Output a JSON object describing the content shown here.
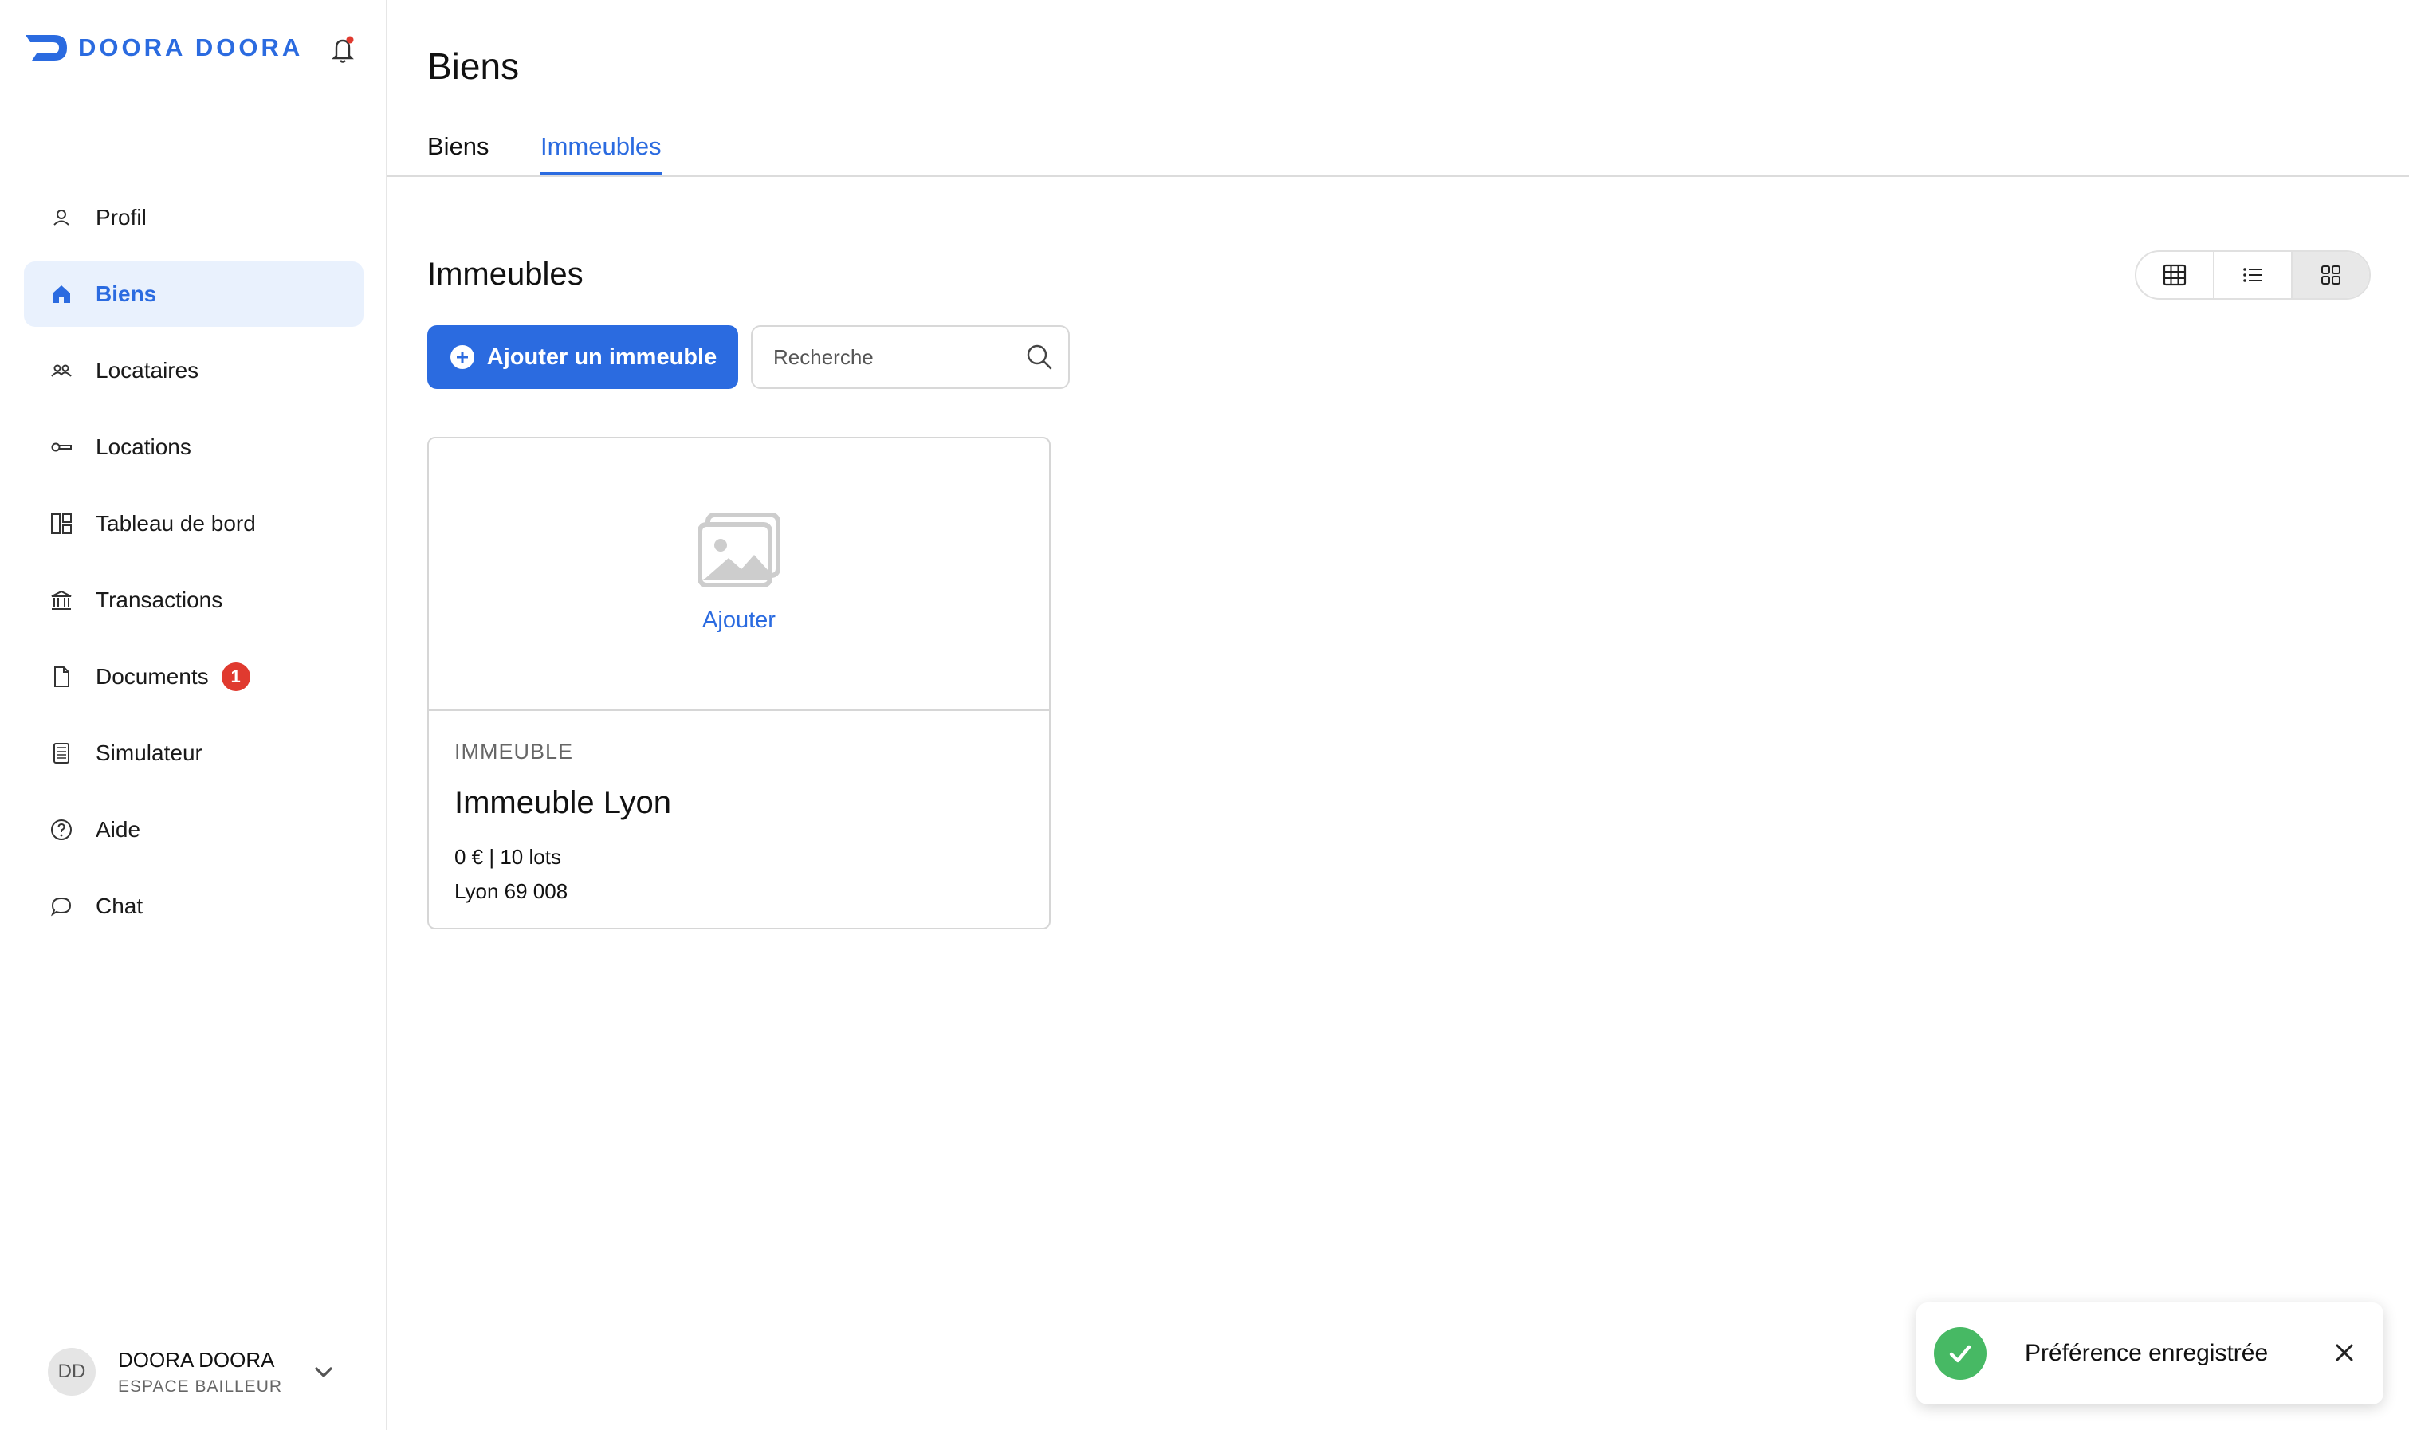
{
  "brand": {
    "name": "DOORA DOORA",
    "accent_color": "#2b6be0"
  },
  "sidebar": {
    "items": [
      {
        "label": "Profil",
        "icon": "user-icon"
      },
      {
        "label": "Biens",
        "icon": "home-icon",
        "active": true
      },
      {
        "label": "Locataires",
        "icon": "users-icon"
      },
      {
        "label": "Locations",
        "icon": "key-icon"
      },
      {
        "label": "Tableau de bord",
        "icon": "dashboard-icon"
      },
      {
        "label": "Transactions",
        "icon": "bank-icon"
      },
      {
        "label": "Documents",
        "icon": "document-icon",
        "badge": "1"
      },
      {
        "label": "Simulateur",
        "icon": "calculator-icon"
      },
      {
        "label": "Aide",
        "icon": "help-icon"
      },
      {
        "label": "Chat",
        "icon": "chat-icon"
      }
    ],
    "user": {
      "initials": "DD",
      "name": "DOORA DOORA",
      "role": "ESPACE BAILLEUR"
    }
  },
  "header": {
    "title": "Biens",
    "tabs": [
      {
        "label": "Biens",
        "active": false
      },
      {
        "label": "Immeubles",
        "active": true
      }
    ]
  },
  "main": {
    "section_title": "Immeubles",
    "add_button_label": "Ajouter un immeuble",
    "search_placeholder": "Recherche",
    "view_modes": [
      "table",
      "list",
      "grid"
    ],
    "selected_view": "grid",
    "cards": [
      {
        "image_action": "Ajouter",
        "type": "IMMEUBLE",
        "title": "Immeuble Lyon",
        "summary": "0 € | 10 lots",
        "location": "Lyon 69 008"
      }
    ]
  },
  "toast": {
    "message": "Préférence enregistrée",
    "status_color": "#47b964"
  }
}
